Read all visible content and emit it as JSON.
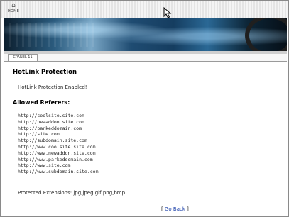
{
  "toolbar": {
    "home_label": "HOME",
    "home_icon": "home-icon"
  },
  "tab": {
    "label": "CPANEL 11"
  },
  "page": {
    "title": "HotLink Protection",
    "status": "HotLink Protection Enabled!",
    "referers_heading": "Allowed Referers:",
    "referers": [
      "http://coolsite.site.com",
      "http://newaddon.site.com",
      "http://parkeddomain.com",
      "http://site.com",
      "http://subdomain.site.com",
      "http://www.coolsite.site.com",
      "http://www.newaddon.site.com",
      "http://www.parkeddomain.com",
      "http://www.site.com",
      "http://www.subdomain.site.com"
    ],
    "extensions": "Protected Extensions: jpg,jpeg,gif,png,bmp",
    "go_back": {
      "open": "[ ",
      "label": "Go Back",
      "close": " ]"
    }
  }
}
